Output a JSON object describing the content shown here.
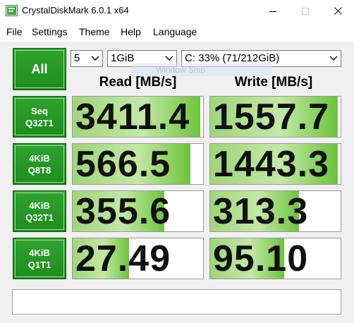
{
  "window": {
    "title": "CrystalDiskMark 6.0.1 x64",
    "icon": "crystaldiskmark-app-icon"
  },
  "menu": [
    "File",
    "Settings",
    "Theme",
    "Help",
    "Language"
  ],
  "controls": {
    "all_button": "All",
    "count_value": "5",
    "size_value": "1GiB",
    "drive_value": "C: 33% (71/212GiB)",
    "overlay_text": "Window Snip"
  },
  "columns": {
    "read": "Read [MB/s]",
    "write": "Write [MB/s]"
  },
  "tests": [
    {
      "line1": "Seq",
      "line2": "Q32T1",
      "read": "3411.4",
      "read_fill": 0.98,
      "write": "1557.7",
      "write_fill": 0.98
    },
    {
      "line1": "4KiB",
      "line2": "Q8T8",
      "read": "566.5",
      "read_fill": 0.9,
      "write": "1443.3",
      "write_fill": 0.98
    },
    {
      "line1": "4KiB",
      "line2": "Q32T1",
      "read": "355.6",
      "read_fill": 0.7,
      "write": "313.3",
      "write_fill": 0.68
    },
    {
      "line1": "4KiB",
      "line2": "Q1T1",
      "read": "27.49",
      "read_fill": 0.43,
      "write": "95.10",
      "write_fill": 0.57
    }
  ],
  "comment": "",
  "colors": {
    "button_green": "#1e8c1e",
    "bar_green": "#6cc43b",
    "background": "#f0f0f0"
  }
}
